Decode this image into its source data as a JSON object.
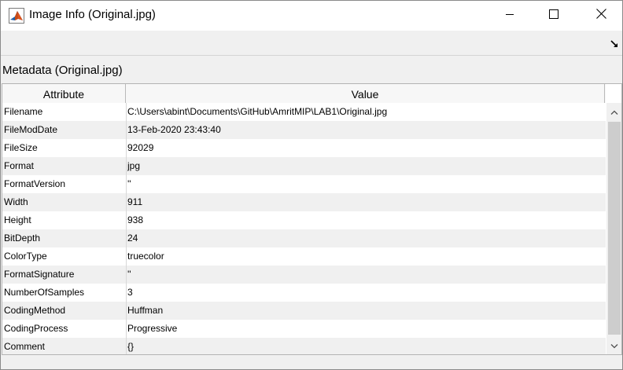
{
  "window": {
    "title": "Image Info (Original.jpg)",
    "app_icon": "matlab-logo-icon",
    "controls": [
      "minimize-icon",
      "maximize-icon",
      "close-icon"
    ]
  },
  "toolbar": {
    "dock_icon": "undock-arrow-icon"
  },
  "section_title": "Metadata (Original.jpg)",
  "table": {
    "columns": [
      "Attribute",
      "Value"
    ],
    "rows": [
      {
        "attribute": "Filename",
        "value": "C:\\Users\\abint\\Documents\\GitHub\\AmritMIP\\LAB1\\Original.jpg"
      },
      {
        "attribute": "FileModDate",
        "value": "13-Feb-2020 23:43:40"
      },
      {
        "attribute": "FileSize",
        "value": "92029"
      },
      {
        "attribute": "Format",
        "value": "jpg"
      },
      {
        "attribute": "FormatVersion",
        "value": "''"
      },
      {
        "attribute": "Width",
        "value": "911"
      },
      {
        "attribute": "Height",
        "value": "938"
      },
      {
        "attribute": "BitDepth",
        "value": "24"
      },
      {
        "attribute": "ColorType",
        "value": "truecolor"
      },
      {
        "attribute": "FormatSignature",
        "value": "''"
      },
      {
        "attribute": "NumberOfSamples",
        "value": "3"
      },
      {
        "attribute": "CodingMethod",
        "value": "Huffman"
      },
      {
        "attribute": "CodingProcess",
        "value": "Progressive"
      },
      {
        "attribute": "Comment",
        "value": "{}"
      }
    ]
  },
  "scrollbar": {
    "up_icon": "chevron-up-icon",
    "down_icon": "chevron-down-icon"
  }
}
